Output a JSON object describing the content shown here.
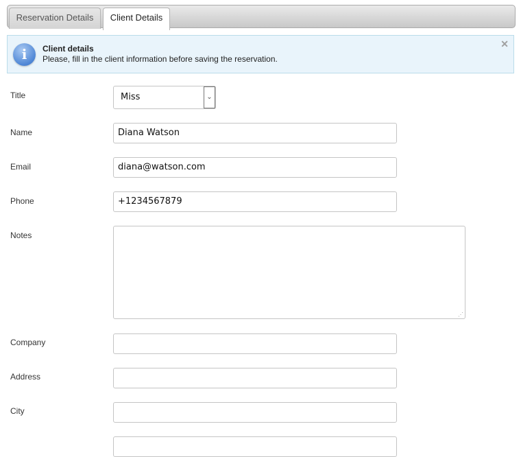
{
  "tabs": [
    {
      "label": "Reservation Details",
      "active": false
    },
    {
      "label": "Client Details",
      "active": true
    }
  ],
  "alert": {
    "icon": "info-icon",
    "icon_glyph": "i",
    "title": "Client details",
    "message": "Please, fill in the client information before saving the reservation.",
    "close_glyph": "✕"
  },
  "form": {
    "title": {
      "label": "Title",
      "value": "Miss",
      "arrow": "⌄"
    },
    "name": {
      "label": "Name",
      "value": "Diana Watson"
    },
    "email": {
      "label": "Email",
      "value": "diana@watson.com"
    },
    "phone": {
      "label": "Phone",
      "value": "+1234567879"
    },
    "notes": {
      "label": "Notes",
      "value": ""
    },
    "company": {
      "label": "Company",
      "value": ""
    },
    "address": {
      "label": "Address",
      "value": ""
    },
    "city": {
      "label": "City",
      "value": ""
    }
  }
}
